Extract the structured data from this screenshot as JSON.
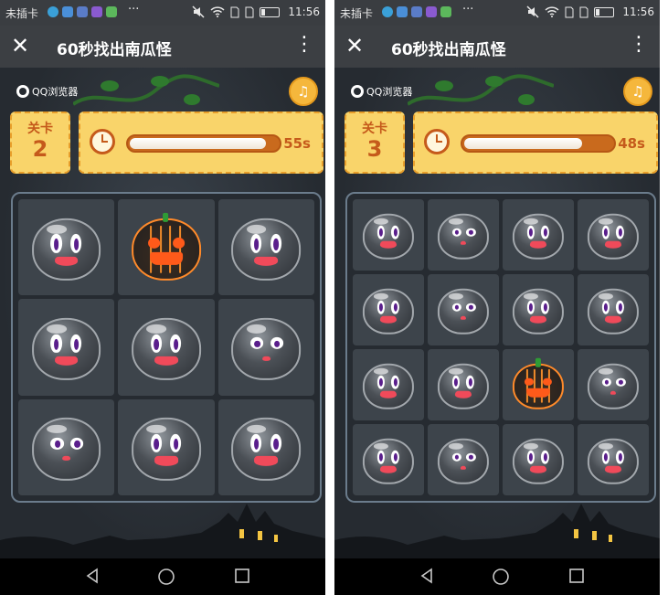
{
  "status_bar": {
    "carrier": "未插卡",
    "dots": "···",
    "time": "11:56"
  },
  "header": {
    "title": "60秒找出南瓜怪"
  },
  "brand": {
    "label": "QQ浏览器"
  },
  "colors": {
    "accent": "#f9d46a",
    "border": "#e89e2a",
    "text": "#c55a1b"
  },
  "screens": [
    {
      "level_label": "关卡",
      "level": "2",
      "time_text": "55s",
      "time_progress": 0.92,
      "grid_size": 3,
      "pumpkin_index": 1,
      "cells": [
        "blob",
        "pumpkin",
        "blob",
        "blob",
        "blob",
        "girl",
        "girl",
        "blob",
        "blob"
      ]
    },
    {
      "level_label": "关卡",
      "level": "3",
      "time_text": "48s",
      "time_progress": 0.8,
      "grid_size": 4,
      "pumpkin_index": 10,
      "cells": [
        "blob",
        "girl",
        "blob",
        "blob",
        "blob",
        "girl",
        "blob",
        "blob",
        "blob",
        "blob",
        "pumpkin",
        "girl",
        "blob",
        "girl",
        "blob",
        "blob"
      ]
    }
  ],
  "icons": {
    "close": "close-icon",
    "more": "more-vert-icon",
    "music": "music-note-icon",
    "timer": "stopwatch-icon",
    "back": "back-triangle-icon",
    "home": "home-circle-icon",
    "recent": "recent-square-icon"
  }
}
